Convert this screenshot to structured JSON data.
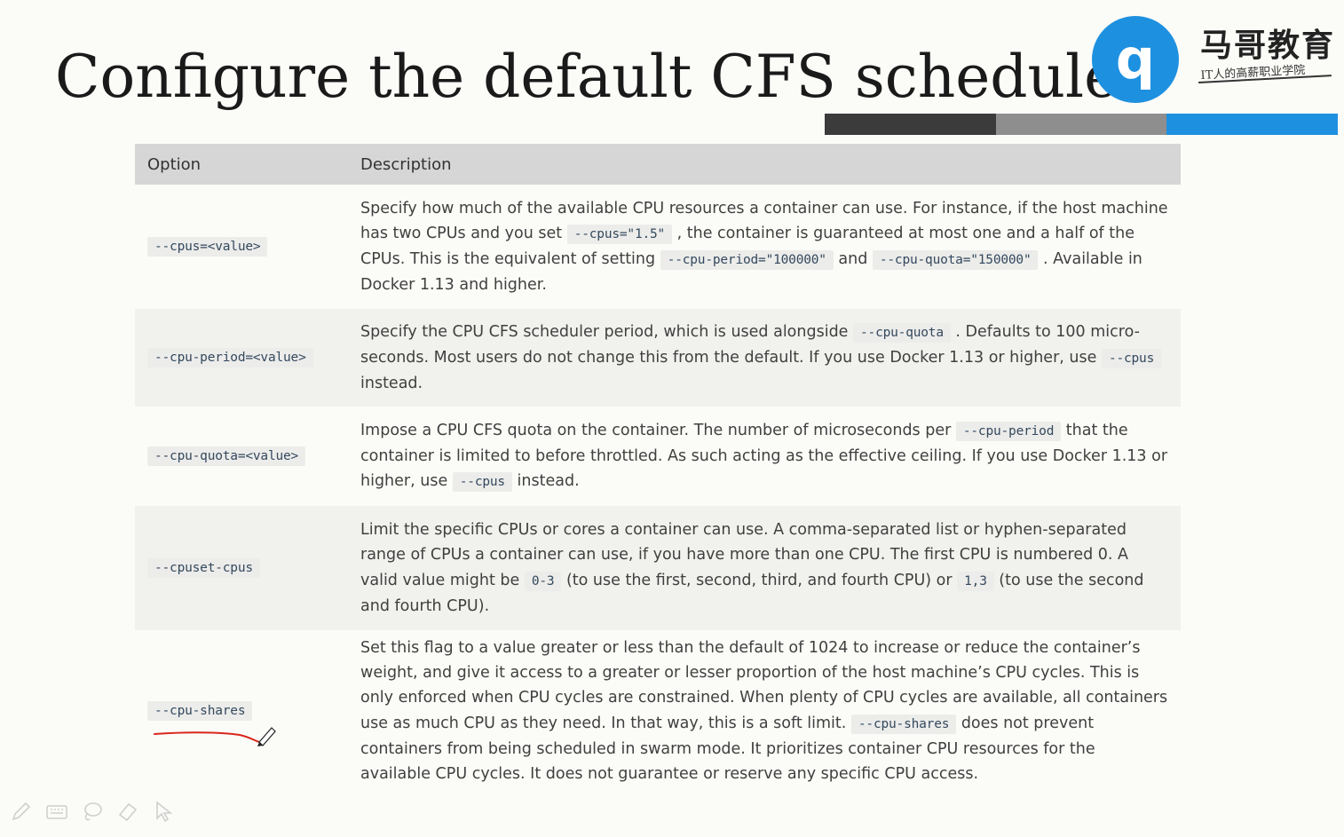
{
  "slide": {
    "title": "Configure the default CFS scheduler"
  },
  "logo": {
    "glyph": "q",
    "name": "马哥教育",
    "tagline": "IT人的高薪职业学院"
  },
  "accent_colors": {
    "blue": "#1e90e0",
    "dark": "#3b3b3b",
    "gray": "#8e8e8e",
    "annotation_red": "#d9261c"
  },
  "table": {
    "headers": {
      "option": "Option",
      "description": "Description"
    },
    "rows": [
      {
        "option": "--cpus=<value>",
        "parts": [
          {
            "t": "Specify how much of the available CPU resources a container can use. For instance, if the host machine has two CPUs and you set "
          },
          {
            "c": "--cpus=\"1.5\""
          },
          {
            "t": " , the container is guaranteed at most one and a half of the CPUs. This is the equivalent of setting "
          },
          {
            "c": "--cpu-period=\"100000\""
          },
          {
            "t": " and "
          },
          {
            "c": "--cpu-quota=\"150000\""
          },
          {
            "t": " . Available in Docker 1.13 and higher."
          }
        ]
      },
      {
        "option": "--cpu-period=<value>",
        "parts": [
          {
            "t": "Specify the CPU CFS scheduler period, which is used alongside "
          },
          {
            "c": "--cpu-quota"
          },
          {
            "t": " . Defaults to 100 micro-seconds. Most users do not change this from the default. If you use Docker 1.13 or higher, use "
          },
          {
            "c": "--cpus"
          },
          {
            "t": " instead."
          }
        ]
      },
      {
        "option": "--cpu-quota=<value>",
        "parts": [
          {
            "t": "Impose a CPU CFS quota on the container. The number of microseconds per "
          },
          {
            "c": "--cpu-period"
          },
          {
            "t": " that the container is limited to before throttled. As such acting as the effective ceiling. If you use Docker 1.13 or higher, use "
          },
          {
            "c": "--cpus"
          },
          {
            "t": " instead."
          }
        ]
      },
      {
        "option": "--cpuset-cpus",
        "parts": [
          {
            "t": "Limit the specific CPUs or cores a container can use. A comma-separated list or hyphen-separated range of CPUs a container can use, if you have more than one CPU. The first CPU is numbered 0. A valid value might be "
          },
          {
            "c": "0-3"
          },
          {
            "t": " (to use the first, second, third, and fourth CPU) or "
          },
          {
            "c": "1,3"
          },
          {
            "t": " (to use the second and fourth CPU)."
          }
        ]
      },
      {
        "option": "--cpu-shares",
        "parts": [
          {
            "t": "Set this flag to a value greater or less than the default of 1024 to increase or reduce the container’s weight, and give it access to a greater or lesser proportion of the host machine’s CPU cycles. This is only enforced when CPU cycles are constrained. When plenty of CPU cycles are available, all containers use as much CPU as they need. In that way, this is a soft limit. "
          },
          {
            "c": "--cpu-shares"
          },
          {
            "t": " does not prevent containers from being scheduled in swarm mode. It prioritizes container CPU resources for the available CPU cycles. It does not guarantee or reserve any specific CPU access."
          }
        ]
      }
    ]
  },
  "toolbar": {
    "tools": [
      "pen-icon",
      "keyboard-icon",
      "lasso-icon",
      "eraser-icon",
      "pointer-icon"
    ]
  }
}
